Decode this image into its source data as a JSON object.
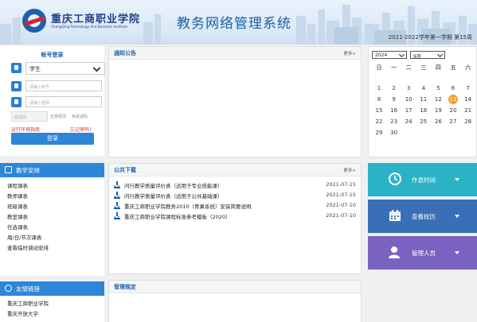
{
  "header": {
    "school_name": "重庆工商职业学院",
    "school_name_en": "ChongQing Technology And Business Institute",
    "site_title": "教务网络管理系统",
    "term": "2021-2022学年第一学期 第15周"
  },
  "login": {
    "title": "帐号登录",
    "role": "学生",
    "account_placeholder": "请输入帐号",
    "password_placeholder": "请输入密码",
    "captcha_placeholder": "验证码",
    "captcha_tip": "正常情况",
    "captcha_image": "免验证码",
    "env_check": "运行环境指南",
    "forgot": "忘记密码?",
    "submit": "登录"
  },
  "teaching": {
    "title": "教学安排",
    "items": [
      "课程课表",
      "教师课表",
      "班级课表",
      "教室课表",
      "任选课表",
      "周/日/节次课表",
      "查看临时调动安排"
    ]
  },
  "links": {
    "title": "友情链接",
    "items": [
      "重庆工商职业学院",
      "重庆开放大学"
    ]
  },
  "notices": {
    "title": "通知公告",
    "more": "更多>"
  },
  "downloads": {
    "title": "公共下载",
    "more": "更多>",
    "items": [
      {
        "title": "问行教学质量评价表（适用于专业技能课）",
        "date": "2021-07-15"
      },
      {
        "title": "问行教学质量评价表（适用于公共基础课）",
        "date": "2021-07-15"
      },
      {
        "title": "重庆工商职业学院教务2010（青果系统）安装简要说明",
        "date": "2021-07-10"
      },
      {
        "title": "重庆工商职业学院课程标准参考模板（2020）",
        "date": "2021-07-10"
      }
    ]
  },
  "rules": {
    "title": "管理规定"
  },
  "calendar": {
    "year": "2024",
    "month": "9月",
    "weekdays": [
      "日",
      "一",
      "二",
      "三",
      "四",
      "五",
      "六"
    ],
    "today": 13,
    "weeks": [
      [
        1,
        2,
        3,
        4,
        5,
        6,
        7
      ],
      [
        8,
        9,
        10,
        11,
        12,
        13,
        14
      ],
      [
        15,
        16,
        17,
        18,
        19,
        20,
        21
      ],
      [
        22,
        23,
        24,
        25,
        26,
        27,
        28
      ],
      [
        29,
        30
      ]
    ]
  },
  "tiles": [
    {
      "label": "作息时间",
      "color": "#2bb3c5",
      "icon": "clock-icon"
    },
    {
      "label": "查看校历",
      "color": "#3a6fb8",
      "icon": "calendar-icon"
    },
    {
      "label": "管理人员",
      "color": "#7a62c0",
      "icon": "user-icon"
    }
  ]
}
